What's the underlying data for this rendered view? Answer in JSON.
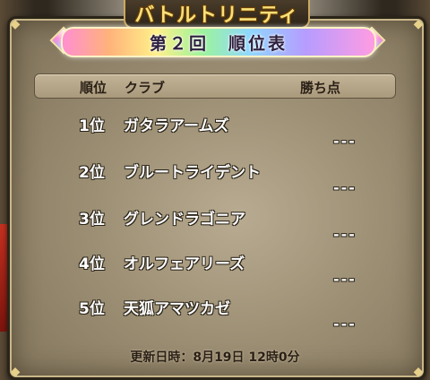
{
  "window": {
    "title": "バトルトリニティ",
    "banner": "第２回　順位表"
  },
  "table": {
    "headers": {
      "rank": "順位",
      "club": "クラブ",
      "points": "勝ち点"
    },
    "rows": [
      {
        "rank": "1位",
        "club": "ガタラアームズ",
        "points": "---"
      },
      {
        "rank": "2位",
        "club": "ブルートライデント",
        "points": "---"
      },
      {
        "rank": "3位",
        "club": "グレンドラゴニア",
        "points": "---"
      },
      {
        "rank": "4位",
        "club": "オルフェアリーズ",
        "points": "---"
      },
      {
        "rank": "5位",
        "club": "天狐アマツカゼ",
        "points": "---"
      }
    ]
  },
  "footer": {
    "updated": "更新日時：8月19日 12時0分"
  }
}
